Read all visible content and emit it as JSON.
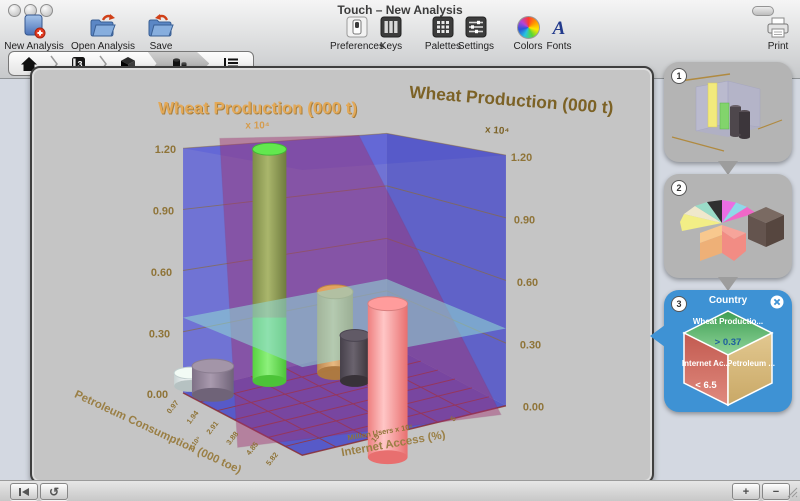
{
  "window": {
    "title": "Touch – New Analysis"
  },
  "toolbar": {
    "new_analysis": "New Analysis",
    "open_analysis": "Open Analysis",
    "save": "Save",
    "preferences": "Preferences",
    "keys": "Keys",
    "palettes": "Palettes",
    "settings": "Settings",
    "colors": "Colors",
    "fonts": "Fonts",
    "print": "Print"
  },
  "breadcrumb": {
    "data_glyph": "3"
  },
  "chart": {
    "title_left": "Wheat Production (000 t)",
    "title_left_scale": "x 10⁴",
    "title_right": "Wheat Production (000 t)",
    "title_right_scale": "x 10⁴",
    "y_ticks_left": [
      "1.20",
      "0.90",
      "0.60",
      "0.30",
      "0.00"
    ],
    "y_ticks_right": [
      "1.20",
      "0.90",
      "0.60",
      "0.30",
      "0.00"
    ],
    "x_axis": {
      "label": "Petroleum Consumption (000 toe)",
      "scale": "x 10⁵",
      "ticks": [
        "0.97",
        "1.94",
        "2.91",
        "3.88",
        "4.85",
        "5.82"
      ]
    },
    "z_axis": {
      "label": "Internet Access (%)",
      "sub_label": "Million Users x 10⁵",
      "ticks": [
        "15",
        "5"
      ]
    }
  },
  "chart_data": {
    "type": "3d-cylinder",
    "title": "Wheat Production (000 t)",
    "ylabel": "Wheat Production (000 t) x 10⁴",
    "ylim": [
      0,
      1.2
    ],
    "cylinders": [
      {
        "color": "#e8f0ee",
        "value": 0.08
      },
      {
        "color": "#8d8092",
        "value": 0.15
      },
      {
        "color": "#66d84a",
        "value": 1.18
      },
      {
        "color": "#d8a060",
        "value": 0.55
      },
      {
        "color": "#4a4348",
        "value": 0.28
      },
      {
        "color": "#f89090",
        "value": 0.62
      }
    ],
    "planes": {
      "horizontal_cyan_at": 0.37,
      "vertical_magenta": "diagonal slice"
    }
  },
  "sidebar": {
    "step1": {
      "badge": "1"
    },
    "step2": {
      "badge": "2"
    },
    "step3": {
      "badge": "3",
      "title": "Country",
      "cube": {
        "top_label": "Wheat Productio...",
        "top_value": "> 0.37",
        "left_label": "Internet Ac...",
        "left_value": "< 6.5",
        "right_label": "Petroleum ..."
      }
    }
  },
  "bottombar": {
    "plus": "+",
    "minus": "−"
  },
  "colors": {
    "accent_blue": "#3e92d4",
    "wall_blue": "#5558d0",
    "plane_cyan": "#8fd6d2",
    "plane_magenta": "#a03070",
    "axis_text": "#8a7340"
  }
}
